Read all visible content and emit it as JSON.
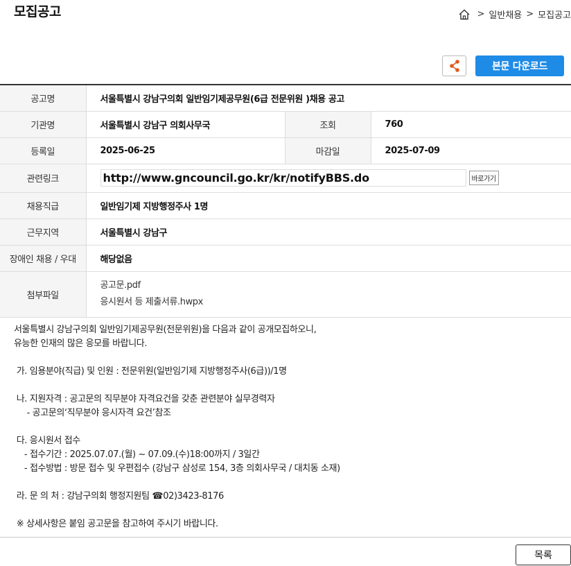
{
  "page_title": "모집공고",
  "breadcrumb": {
    "items": [
      "일반채용",
      "모집공고"
    ],
    "separator": ">"
  },
  "toolbar": {
    "share_icon": "share-icon",
    "download_label": "본문 다운로드"
  },
  "info": {
    "title_label": "공고명",
    "title_value": "서울특별시 강남구의회 일반임기제공무원(6급 전문위원 )채용 공고",
    "org_label": "기관명",
    "org_value": "서울특별시 강남구 의회사무국",
    "views_label": "조회",
    "views_value": "760",
    "reg_label": "등록일",
    "reg_value": "2025-06-25",
    "deadline_label": "마감일",
    "deadline_value": "2025-07-09",
    "link_label": "관련링크",
    "link_value": "http://www.gncouncil.go.kr/kr/notifyBBS.do",
    "goto_label": "바로가기",
    "position_label": "채용직급",
    "position_value": "일반임기제 지방행정주사 1명",
    "area_label": "근무지역",
    "area_value": "서울특별시 강남구",
    "disability_label": "장애인 채용 / 우대",
    "disability_value": "해당없음",
    "files_label": "첨부파일",
    "files": [
      "공고문.pdf",
      "응시원서 등 제출서류.hwpx"
    ]
  },
  "body": {
    "lines": [
      "서울특별시 강남구의회 일반임기제공무원(전문위원)을 다음과 같이 공개모집하오니,",
      "유능한 인재의 많은 응모를 바랍니다.",
      "",
      " 가. 임용분야(직급) 및 인원 : 전문위원(일반임기제 지방행정주사(6급))/1명",
      "",
      " 나. 지원자격 : 공고문의 직무분야 자격요건을 갖춘 관련분야 실무경력자",
      "     - 공고문의‘직무분야 응시자격 요건’참조",
      "",
      " 다. 응시원서 접수",
      "    - 접수기간 : 2025.07.07.(월) ~ 07.09.(수)18:00까지 / 3일간",
      "    - 접수방법 : 방문 접수 및 우편접수 (강남구 삼성로 154, 3층 의회사무국 / 대치동 소재)",
      "",
      " 라. 문 의 처 : 강남구의회 행정지원팀 ☎02)3423-8176",
      "",
      " ※ 상세사항은 붙임 공고문을 참고하여 주시기 바랍니다."
    ]
  },
  "footer": {
    "list_label": "목록"
  },
  "colors": {
    "accent": "#1e8be6",
    "share_icon": "#e05a1c"
  }
}
